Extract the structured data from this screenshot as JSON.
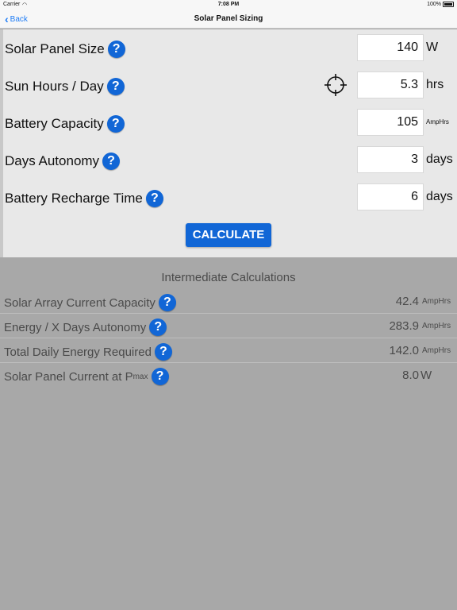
{
  "status": {
    "carrier": "Carrier",
    "time": "7:08 PM",
    "battery": "100%"
  },
  "nav": {
    "back_label": "Back",
    "title": "Solar Panel Sizing"
  },
  "inputs": [
    {
      "label": "Solar Panel Size",
      "value": "140",
      "unit": "W"
    },
    {
      "label": "Sun Hours / Day",
      "value": "5.3",
      "unit": "hrs"
    },
    {
      "label": "Battery Capacity",
      "value": "105",
      "unit": "AmpHrs"
    },
    {
      "label": "Days Autonomy",
      "value": "3",
      "unit": "days"
    },
    {
      "label": "Battery Recharge Time",
      "value": "6",
      "unit": "days"
    }
  ],
  "help_symbol": "?",
  "calculate_label": "CALCULATE",
  "results": {
    "heading": "Intermediate Calculations",
    "rows": [
      {
        "label": "Solar Array Current Capacity",
        "value": "42.4",
        "unit": "AmpHrs"
      },
      {
        "label": "Energy / X Days Autonomy",
        "value": "283.9",
        "unit": "AmpHrs"
      },
      {
        "label": "Total Daily Energy Required",
        "value": "142.0",
        "unit": "AmpHrs"
      },
      {
        "label": "Solar Panel Current at P",
        "label_sub": "max",
        "value": "8.0",
        "unit": "W"
      }
    ]
  },
  "colors": {
    "accent": "#1166d6",
    "link": "#1e7cf6",
    "panel": "#e8e8e8",
    "background": "#a8a8a8"
  }
}
